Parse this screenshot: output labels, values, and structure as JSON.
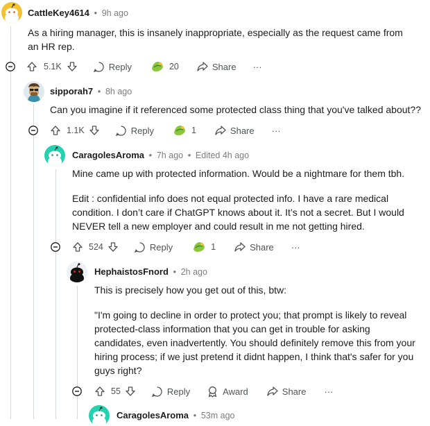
{
  "comments": [
    {
      "username": "CattleKey4614",
      "separator": "•",
      "time": "9h ago",
      "edited": "",
      "paragraphs": [
        "As a hiring manager, this is insanely inappropriate, especially as the request came from an HR rep."
      ],
      "votes": "5.1K",
      "reply_label": "Reply",
      "award_count": "20",
      "share_label": "Share",
      "more_label": "···"
    },
    {
      "username": "sipporah7",
      "separator": "•",
      "time": "8h ago",
      "edited": "",
      "paragraphs": [
        "Can you imagine if it referenced some protected class thing that you've talked about??"
      ],
      "votes": "1.1K",
      "reply_label": "Reply",
      "award_count": "1",
      "share_label": "Share",
      "more_label": "···"
    },
    {
      "username": "CaragolesAroma",
      "separator": "•",
      "time": "7h ago",
      "edited": "Edited 4h ago",
      "paragraphs": [
        "Mine came up with protected information. Would be a nightmare for them tbh.",
        "Edit : confidential info does not equal protected info. I have a rare medical condition. I don’t care if ChatGPT knows about it. It’s not a secret. But I would NEVER tell a new employer and could result in me not getting hired."
      ],
      "votes": "524",
      "reply_label": "Reply",
      "award_count": "1",
      "share_label": "Share",
      "more_label": "···"
    },
    {
      "username": "HephaistosFnord",
      "separator": "•",
      "time": "2h ago",
      "edited": "",
      "paragraphs": [
        "This is precisely how you get out of this, btw:",
        "\"I'm going to decline in order to protect you; that prompt is likely to reveal protected-class information that you can get in trouble for asking candidates, even inadvertently. You should definitely remove this from your hiring process; if we just pretend it didnt happen, I think that's safer for you guys right?"
      ],
      "votes": "55",
      "reply_label": "Reply",
      "award_label": "Award",
      "share_label": "Share",
      "more_label": "···"
    },
    {
      "username": "CaragolesAroma",
      "separator": "•",
      "time": "53m ago"
    }
  ],
  "colors": {
    "thread_line": "#d7dadc",
    "username": "#1c1c1c",
    "meta": "#7c7c7c",
    "action": "#4f5357",
    "avatar_yellow": "#f2c230",
    "avatar_teal": "#24d1b0"
  },
  "icons": [
    "snoo-avatar-icon",
    "collapse-icon",
    "upvote-icon",
    "downvote-icon",
    "reply-icon",
    "award-icon",
    "share-icon",
    "more-icon"
  ]
}
